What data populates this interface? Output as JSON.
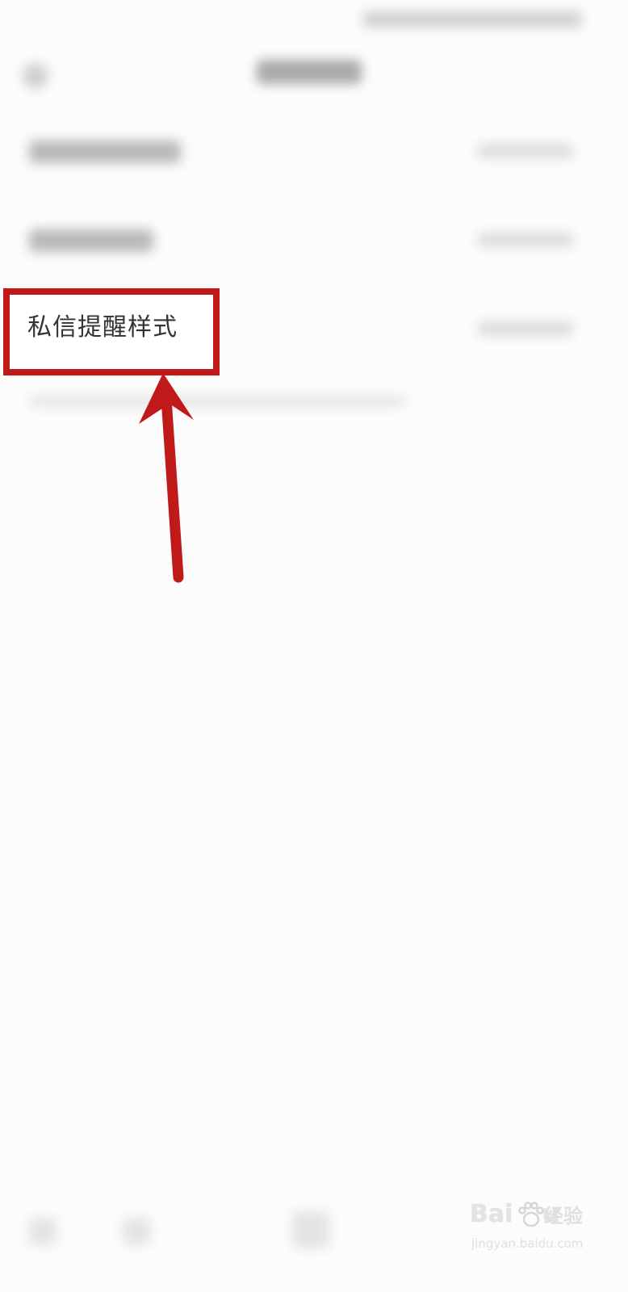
{
  "highlighted_item": {
    "label": "私信提醒样式"
  },
  "annotation": {
    "color": "#c0191a",
    "arrow_icon": "up-arrow-icon"
  },
  "watermark": {
    "logo_text": "Bai",
    "logo_text_tail": "u",
    "brand": "经验",
    "url": "jingyan.baidu.com"
  }
}
